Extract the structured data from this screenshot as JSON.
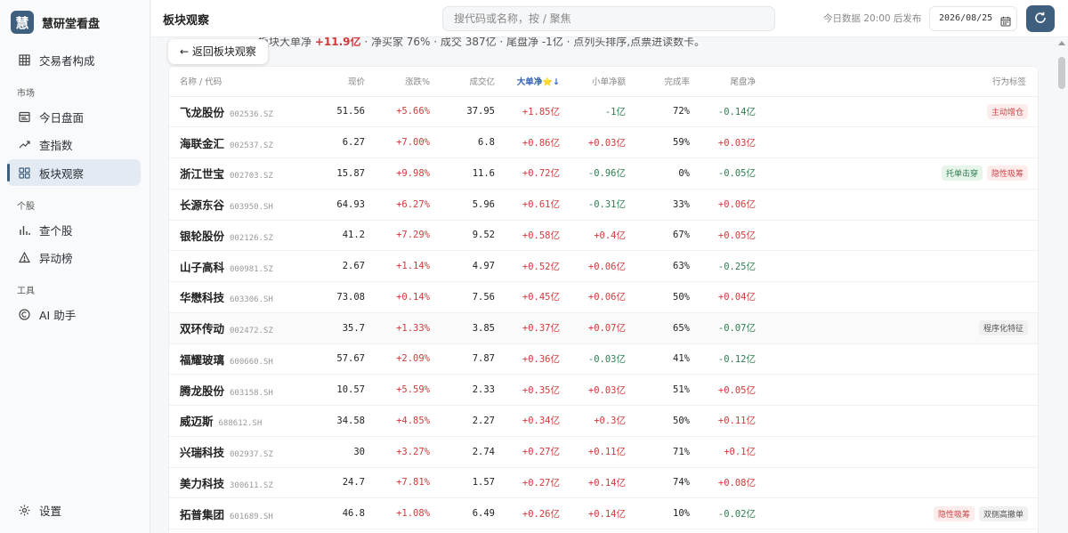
{
  "brand": {
    "logo_char": "慧",
    "name": "慧研堂看盘"
  },
  "sidebar": {
    "top_item": {
      "label": "交易者构成",
      "icon": "grid-icon"
    },
    "market_section": "市场",
    "market_items": [
      {
        "label": "今日盘面",
        "icon": "board-icon"
      },
      {
        "label": "查指数",
        "icon": "trend-icon"
      },
      {
        "label": "板块观察",
        "icon": "sector-grid-icon",
        "active": true
      }
    ],
    "stock_section": "个股",
    "stock_items": [
      {
        "label": "查个股",
        "icon": "bar-chart-icon"
      },
      {
        "label": "异动榜",
        "icon": "alert-icon"
      }
    ],
    "tools_section": "工具",
    "tools_items": [
      {
        "label": "AI 助手",
        "icon": "ai-icon"
      }
    ],
    "settings_label": "设置"
  },
  "header": {
    "title": "板块观察",
    "search_placeholder": "搜代码或名称，按 / 聚焦",
    "publish_note": "今日数据 20:00 后发布",
    "date": "2026/08/25"
  },
  "summary": {
    "prefix": "板块大单净 ",
    "big_net": "+11.9亿",
    "rest": " · 净买家 76% · 成交 387亿 · 尾盘净 -1亿 · 点列头排序,点票进读数卡。"
  },
  "back_button": "← 返回板块观察",
  "table": {
    "headers": {
      "name": "名称 / 代码",
      "price": "现价",
      "change": "涨跌%",
      "volume": "成交亿",
      "big_net": "大单净⭐↓",
      "small_net": "小单净额",
      "completion": "完成率",
      "tail_net": "尾盘净",
      "tags": "行为标签"
    },
    "rows": [
      {
        "name": "飞龙股份",
        "code": "002536.SZ",
        "price": "51.56",
        "change": "+5.66%",
        "volume": "37.95",
        "big_net": "+1.85亿",
        "small_net": "-1亿",
        "small_dir": "down",
        "completion": "72%",
        "tail_net": "-0.14亿",
        "tail_dir": "down",
        "tags": [
          {
            "text": "主动增仓",
            "color": "red"
          }
        ]
      },
      {
        "name": "海联金汇",
        "code": "002537.SZ",
        "price": "6.27",
        "change": "+7.00%",
        "volume": "6.8",
        "big_net": "+0.86亿",
        "small_net": "+0.03亿",
        "small_dir": "up",
        "completion": "59%",
        "tail_net": "+0.03亿",
        "tail_dir": "up",
        "tags": []
      },
      {
        "name": "浙江世宝",
        "code": "002703.SZ",
        "price": "15.87",
        "change": "+9.98%",
        "volume": "11.6",
        "big_net": "+0.72亿",
        "small_net": "-0.96亿",
        "small_dir": "down",
        "completion": "0%",
        "tail_net": "-0.05亿",
        "tail_dir": "down",
        "tags": [
          {
            "text": "托单击穿",
            "color": "green"
          },
          {
            "text": "隐性吸筹",
            "color": "red"
          }
        ]
      },
      {
        "name": "长源东谷",
        "code": "603950.SH",
        "price": "64.93",
        "change": "+6.27%",
        "volume": "5.96",
        "big_net": "+0.61亿",
        "small_net": "-0.31亿",
        "small_dir": "down",
        "completion": "33%",
        "tail_net": "+0.06亿",
        "tail_dir": "up",
        "tags": []
      },
      {
        "name": "银轮股份",
        "code": "002126.SZ",
        "price": "41.2",
        "change": "+7.29%",
        "volume": "9.52",
        "big_net": "+0.58亿",
        "small_net": "+0.4亿",
        "small_dir": "up",
        "completion": "67%",
        "tail_net": "+0.05亿",
        "tail_dir": "up",
        "tags": []
      },
      {
        "name": "山子高科",
        "code": "000981.SZ",
        "price": "2.67",
        "change": "+1.14%",
        "volume": "4.97",
        "big_net": "+0.52亿",
        "small_net": "+0.06亿",
        "small_dir": "up",
        "completion": "63%",
        "tail_net": "-0.25亿",
        "tail_dir": "down",
        "tags": []
      },
      {
        "name": "华懋科技",
        "code": "603306.SH",
        "price": "73.08",
        "change": "+0.14%",
        "volume": "7.56",
        "big_net": "+0.45亿",
        "small_net": "+0.06亿",
        "small_dir": "up",
        "completion": "50%",
        "tail_net": "+0.04亿",
        "tail_dir": "up",
        "tags": []
      },
      {
        "name": "双环传动",
        "code": "002472.SZ",
        "price": "35.7",
        "change": "+1.33%",
        "volume": "3.85",
        "big_net": "+0.37亿",
        "small_net": "+0.07亿",
        "small_dir": "up",
        "completion": "65%",
        "tail_net": "-0.07亿",
        "tail_dir": "down",
        "tags": [
          {
            "text": "程序化特征",
            "color": "gray"
          }
        ],
        "hover": true
      },
      {
        "name": "福耀玻璃",
        "code": "600660.SH",
        "price": "57.67",
        "change": "+2.09%",
        "volume": "7.87",
        "big_net": "+0.36亿",
        "small_net": "-0.03亿",
        "small_dir": "down",
        "completion": "41%",
        "tail_net": "-0.12亿",
        "tail_dir": "down",
        "tags": []
      },
      {
        "name": "腾龙股份",
        "code": "603158.SH",
        "price": "10.57",
        "change": "+5.59%",
        "volume": "2.33",
        "big_net": "+0.35亿",
        "small_net": "+0.03亿",
        "small_dir": "up",
        "completion": "51%",
        "tail_net": "+0.05亿",
        "tail_dir": "up",
        "tags": []
      },
      {
        "name": "威迈斯",
        "code": "688612.SH",
        "price": "34.58",
        "change": "+4.85%",
        "volume": "2.27",
        "big_net": "+0.34亿",
        "small_net": "+0.3亿",
        "small_dir": "up",
        "completion": "50%",
        "tail_net": "+0.11亿",
        "tail_dir": "up",
        "tags": []
      },
      {
        "name": "兴瑞科技",
        "code": "002937.SZ",
        "price": "30",
        "change": "+3.27%",
        "volume": "2.74",
        "big_net": "+0.27亿",
        "small_net": "+0.11亿",
        "small_dir": "up",
        "completion": "71%",
        "tail_net": "+0.1亿",
        "tail_dir": "up",
        "tags": []
      },
      {
        "name": "美力科技",
        "code": "300611.SZ",
        "price": "24.7",
        "change": "+7.81%",
        "volume": "1.57",
        "big_net": "+0.27亿",
        "small_net": "+0.14亿",
        "small_dir": "up",
        "completion": "74%",
        "tail_net": "+0.08亿",
        "tail_dir": "up",
        "tags": []
      },
      {
        "name": "拓普集团",
        "code": "601689.SH",
        "price": "46.8",
        "change": "+1.08%",
        "volume": "6.49",
        "big_net": "+0.26亿",
        "small_net": "+0.14亿",
        "small_dir": "up",
        "completion": "10%",
        "tail_net": "-0.02亿",
        "tail_dir": "down",
        "tags": [
          {
            "text": "隐性吸筹",
            "color": "red"
          },
          {
            "text": "双侧高撤单",
            "color": "gray"
          }
        ]
      }
    ]
  },
  "colors": {
    "accent": "#3f5f7e",
    "up": "#d03a3a",
    "down": "#2e7d4f",
    "sorted_header": "#3161b7"
  }
}
